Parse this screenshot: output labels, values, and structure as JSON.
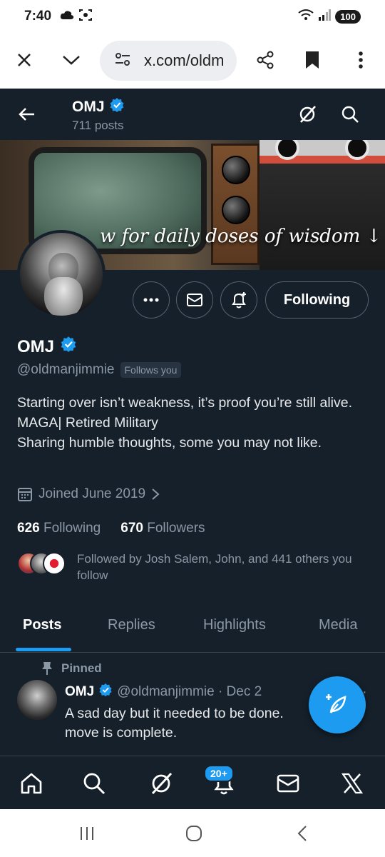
{
  "status_bar": {
    "time": "7:40",
    "battery": "100",
    "icons": [
      "cloud-icon",
      "screenshot-icon",
      "wifi-icon",
      "signal-icon"
    ]
  },
  "browser": {
    "url": "x.com/oldm",
    "icons": [
      "close-icon",
      "chevron-down-icon",
      "site-settings-icon",
      "share-icon",
      "bookmark-icon",
      "more-vertical-icon"
    ]
  },
  "header": {
    "title": "OMJ",
    "posts_count": "711 posts"
  },
  "banner": {
    "text": "w for daily doses of wisdom ↓"
  },
  "actions": {
    "follow_label": "Following"
  },
  "profile": {
    "name": "OMJ",
    "handle": "@oldmanjimmie",
    "follows_you": "Follows you",
    "bio": [
      "Starting over isn’t weakness, it’s proof you’re still alive.",
      "MAGA| Retired Military",
      "Sharing humble thoughts, some you may not like."
    ],
    "joined": "Joined June 2019",
    "following_count": "626",
    "following_label": "Following",
    "followers_count": "670",
    "followers_label": "Followers",
    "followed_by": "Followed by Josh Salem, John, and 441 others you follow"
  },
  "tabs": [
    "Posts",
    "Replies",
    "Highlights",
    "Media"
  ],
  "tweet": {
    "pinned_label": "Pinned",
    "name": "OMJ",
    "handle_date": "@oldmanjimmie · Dec 2",
    "text": "A sad day but it needed to be done. move is complete."
  },
  "bottom_nav": {
    "notification_badge": "20+",
    "icons": [
      "home-icon",
      "search-icon",
      "grok-icon",
      "notifications-icon",
      "messages-icon",
      "x-logo-icon"
    ]
  },
  "colors": {
    "background": "#15202b",
    "accent": "#1d9bf0",
    "muted_text": "#8b98a5",
    "border": "#38444d"
  }
}
